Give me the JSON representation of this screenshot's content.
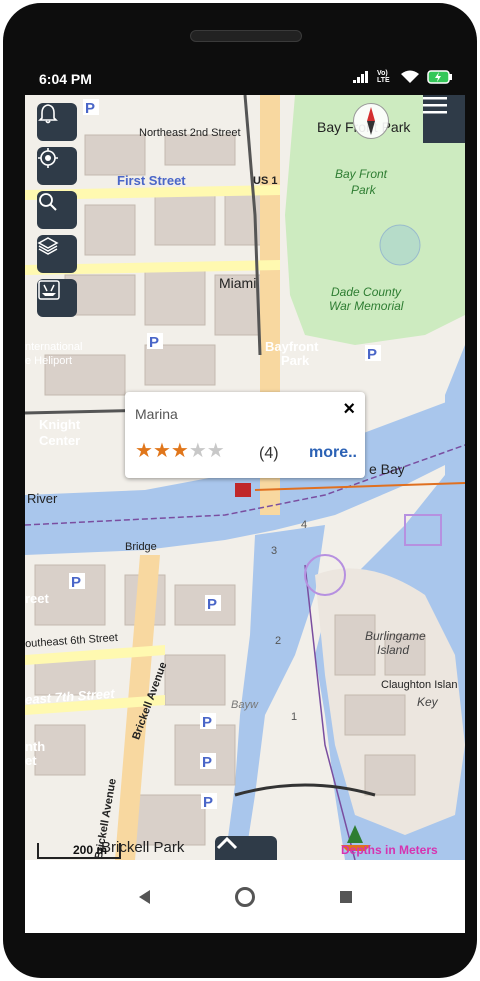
{
  "status_bar": {
    "time": "6:04 PM",
    "icons": [
      "signal-icon",
      "volte-icon",
      "wifi-icon",
      "battery-charging-icon"
    ],
    "volte_label": "Vo) LTE"
  },
  "map": {
    "labels": {
      "northeast_2nd_street": "Northeast 2nd Street",
      "first_street": "First Street",
      "us1": "US 1",
      "bay_front_park_title": "Bay Front Park",
      "bay_front_park_green_1": "Bay Front",
      "bay_front_park_green_2": "Park",
      "miami": "Miami",
      "dade_county_1": "Dade County",
      "dade_county_2": "War Memorial",
      "bayfront_1": "Bayfront",
      "bayfront_2": "Park",
      "international_1": "nternational",
      "heliport": "e Heliport",
      "knight_1": "Knight",
      "knight_2": "Center",
      "river": "River",
      "bridge": "Bridge",
      "e_bay": "e Bay",
      "street_left": "reet",
      "southeast_6th": "outheast 6th Street",
      "east_7th": "east 7th Street",
      "brickell_avenue": "Brickell Avenue",
      "brickell_avenue_2": "Brickell Avenue",
      "burlingame_1": "Burlingame",
      "burlingame_2": "Island",
      "claughton": "Claughton Islan",
      "key": "Key",
      "nth": "nth",
      "et": "et",
      "brickell_park": "Brickell Park",
      "bayw": "Bayw",
      "depth_3": "3",
      "depth_4": "4",
      "depth_2": "2",
      "depth_1": "1"
    },
    "scale_label": "200 m",
    "depths_label": "Depths in Meters",
    "colors": {
      "water": "#a9c6ec",
      "park": "#cdebc0",
      "building": "#d9d0c9",
      "road_major": "#f8d8a0",
      "toolbar": "#2f3b48",
      "accent_link": "#2c62b5",
      "depths_label": "#d633b0",
      "pointer_line": "#e07020"
    }
  },
  "toolbar": {
    "buttons": [
      "bell-icon",
      "locate-icon",
      "search-icon",
      "layers-icon",
      "boat-icon"
    ]
  },
  "popup": {
    "title": "Marina",
    "rating": 3,
    "max_rating": 5,
    "review_count": "(4)",
    "more_label": "more..",
    "close_label": "×"
  },
  "nav": {
    "buttons": [
      "back-icon",
      "home-icon",
      "recents-icon"
    ]
  }
}
